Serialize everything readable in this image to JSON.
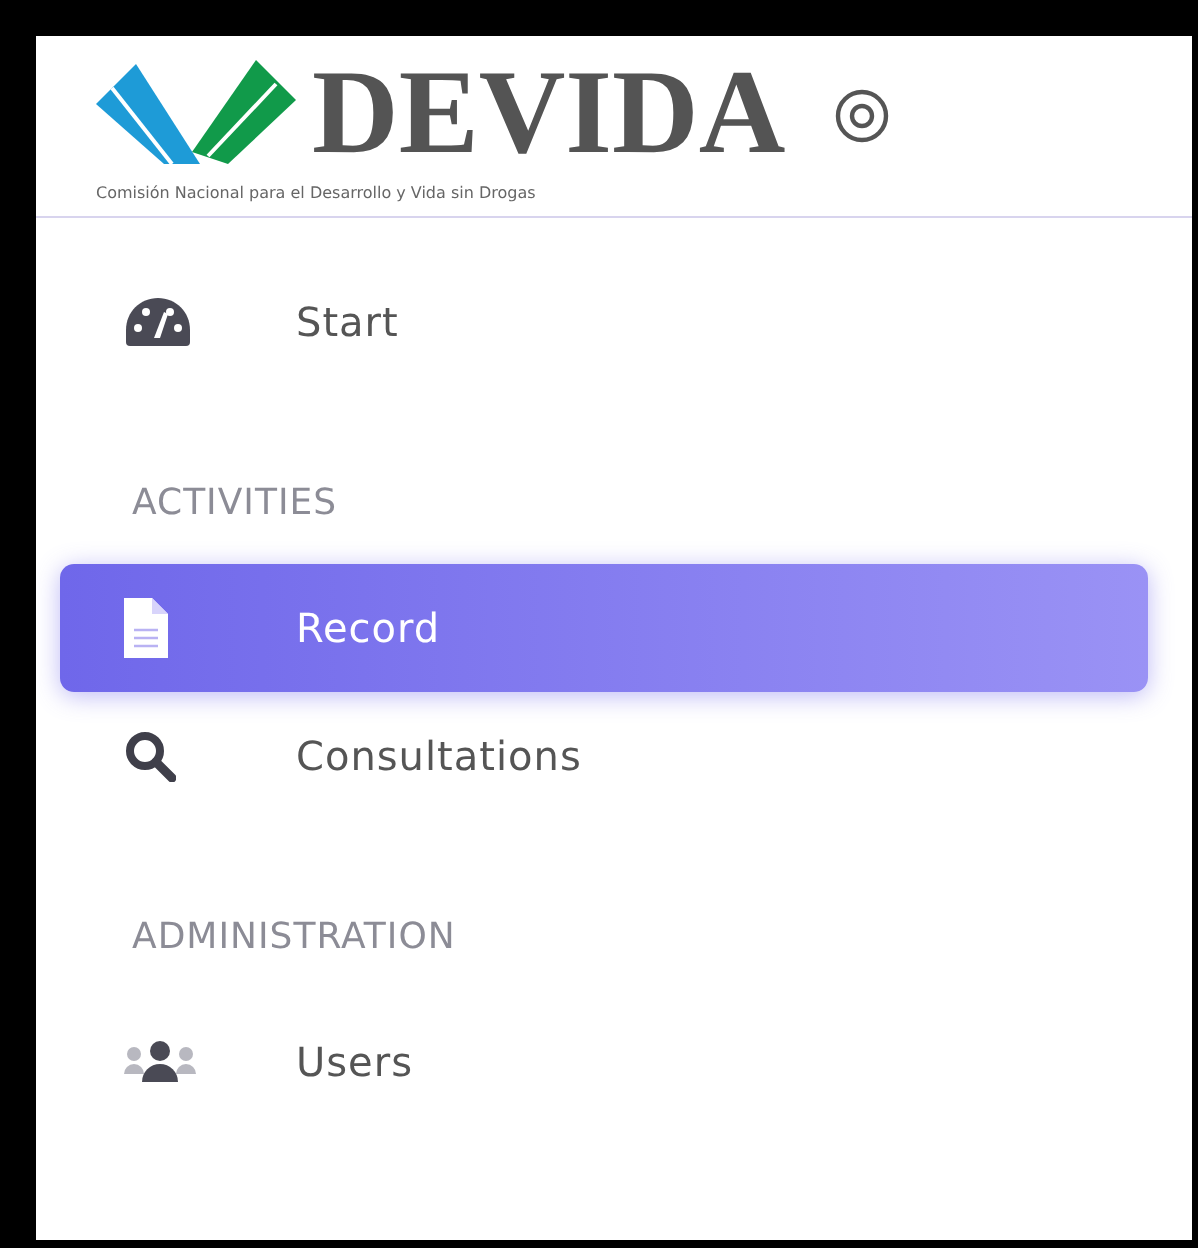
{
  "header": {
    "logo_title": "DEVIDA",
    "logo_subtitle": "Comisión Nacional para el Desarrollo y Vida sin Drogas"
  },
  "sidebar": {
    "items": [
      {
        "kind": "link",
        "label": "Start",
        "selected": false
      },
      {
        "kind": "heading",
        "label": "ACTIVITIES"
      },
      {
        "kind": "link",
        "label": "Record",
        "selected": true
      },
      {
        "kind": "link",
        "label": "Consultations",
        "selected": false
      },
      {
        "kind": "heading",
        "label": "ADMINISTRATION"
      },
      {
        "kind": "link",
        "label": "Users",
        "selected": false
      }
    ]
  }
}
